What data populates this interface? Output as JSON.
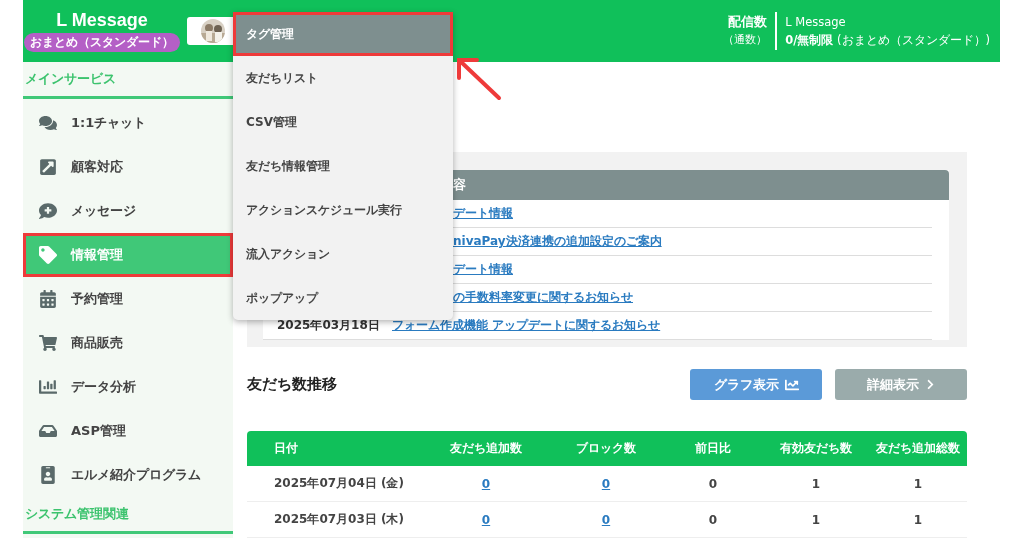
{
  "header": {
    "logo": "L Message",
    "plan_badge": "おまとめ（スタンダード）",
    "delivery_label": "配信数",
    "delivery_unit": "（通数）",
    "account_name": "L Message",
    "delivery_count": "**0/無制限** (おまとめ（スタンダード）)"
  },
  "sidebar": {
    "sections": [
      {
        "title": "メインサービス",
        "items": [
          {
            "label": "1:1チャット",
            "selected": false,
            "annotated": false
          },
          {
            "label": "顧客対応",
            "selected": false,
            "annotated": false
          },
          {
            "label": "メッセージ",
            "selected": false,
            "annotated": false
          },
          {
            "label": "情報管理",
            "selected": true,
            "annotated": true
          },
          {
            "label": "予約管理",
            "selected": false,
            "annotated": false
          },
          {
            "label": "商品販売",
            "selected": false,
            "annotated": false
          },
          {
            "label": "データ分析",
            "selected": false,
            "annotated": false
          },
          {
            "label": "ASP管理",
            "selected": false,
            "annotated": false
          },
          {
            "label": "エルメ紹介プログラム",
            "selected": false,
            "annotated": false
          }
        ]
      },
      {
        "title": "システム管理関連"
      }
    ]
  },
  "dropdown": {
    "items": [
      {
        "label": "タグ管理",
        "selected": true,
        "annotated": true
      },
      {
        "label": "友だちリスト",
        "selected": false,
        "annotated": false
      },
      {
        "label": "CSV管理",
        "selected": false,
        "annotated": false
      },
      {
        "label": "友だち情報管理",
        "selected": false,
        "annotated": false
      },
      {
        "label": "アクションスケジュール実行",
        "selected": false,
        "annotated": false
      },
      {
        "label": "流入アクション",
        "selected": false,
        "annotated": false
      },
      {
        "label": "ポップアップ",
        "selected": false,
        "annotated": false
      }
    ]
  },
  "news": {
    "header": {
      "label": "容",
      "clipped": true
    },
    "rows": [
      {
        "title": "デート情報",
        "clipped": true
      },
      {
        "title": "nivaPay決済連携の追加設定のご案内",
        "clipped": true
      },
      {
        "title": "デート情報",
        "clipped": true
      },
      {
        "title": "の手数料率変更に関するお知らせ",
        "clipped": true
      },
      {
        "date": "2025年03月18日",
        "title": "フォーム作成機能 アップデートに関するお知らせ",
        "clipped": false
      }
    ]
  },
  "friends": {
    "title": "友だち数推移",
    "buttons": [
      {
        "label": "グラフ表示",
        "kind": "graph"
      },
      {
        "label": "詳細表示",
        "kind": "detail"
      }
    ],
    "columns": [
      {
        "label": "日付",
        "kind": "date"
      },
      {
        "label": "友だち追加数",
        "kind": "link"
      },
      {
        "label": "ブロック数",
        "kind": "link"
      },
      {
        "label": "前日比",
        "kind": "text"
      },
      {
        "label": "有効友だち数",
        "kind": "text"
      },
      {
        "label": "友だち追加総数",
        "kind": "text"
      }
    ],
    "rows": [
      [
        "2025年07月04日 (金)",
        "0",
        "0",
        "0",
        "1",
        "1"
      ],
      [
        "2025年07月03日 (木)",
        "0",
        "0",
        "0",
        "1",
        "1"
      ]
    ]
  }
}
